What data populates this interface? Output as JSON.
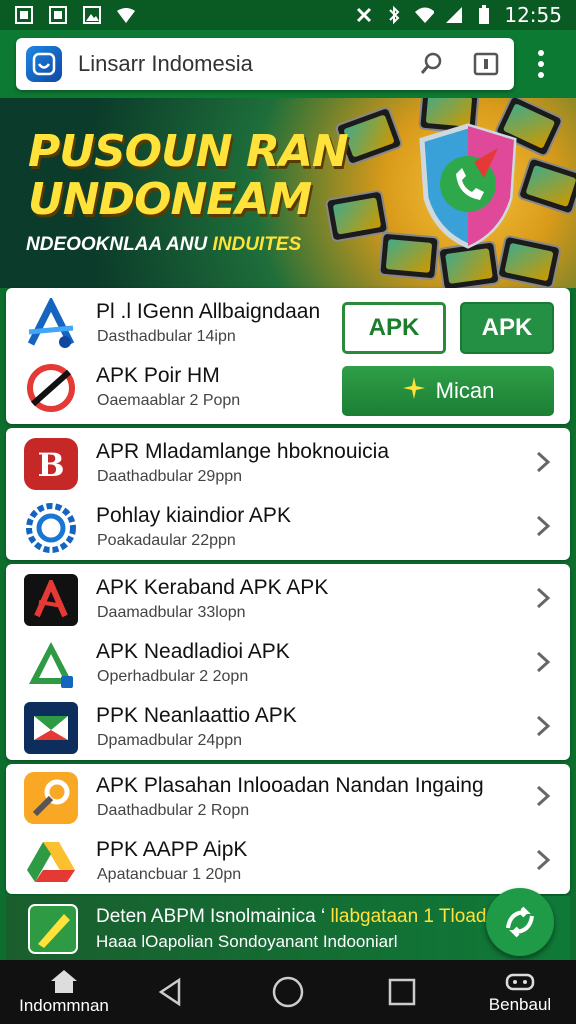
{
  "status_bar": {
    "time": "12:55",
    "left_icons": [
      "notification-square-icon",
      "notification-square-icon",
      "image-icon",
      "vpn-shield-icon"
    ],
    "right_icons": [
      "nfc-icon",
      "bluetooth-icon",
      "wifi-icon",
      "signal-icon",
      "battery-icon"
    ]
  },
  "search": {
    "text": "Linsarr Indomesia"
  },
  "banner": {
    "title_line1": "PUSOUN RAN",
    "title_line2": "UNDONEAM",
    "subtitle_white": "NDEOOKNLAA ANU ",
    "subtitle_yellow": "INDUITES"
  },
  "cards": [
    {
      "rows": [
        {
          "title": "Pl .l IGenn Allbaigndaan",
          "sub": "Dasthadbular 14ipn"
        },
        {
          "title": "APK Poir HM",
          "sub": "Oaemaablar 2 Popn"
        }
      ],
      "buttons": {
        "apk_outline": "APK",
        "apk_filled": "APK",
        "mican": "Mican"
      }
    },
    {
      "rows": [
        {
          "title": "APR Mladamlange hboknouicia",
          "sub": "Daathadbular 29ppn"
        },
        {
          "title": "Pohlay kiaindior APK",
          "sub": "Poakadaular 22ppn"
        }
      ]
    },
    {
      "rows": [
        {
          "title": "APK Keraband APK APK",
          "sub": "Daamadbular 33lopn"
        },
        {
          "title": "APK Neadladioi APK",
          "sub": "Operhadbular 2 2opn"
        },
        {
          "title": "PPK Neanlaattio APK",
          "sub": "Dpamadbular 24ppn"
        }
      ]
    },
    {
      "rows": [
        {
          "title": "APK Plasahan Inlooadan Nandan Ingaing",
          "sub": "Daathadbular 2 Ropn"
        },
        {
          "title": "PPK AAPP AipK",
          "sub": "Apatancbuar 1 20pn"
        }
      ]
    }
  ],
  "promo": {
    "line1_white": "Deten ABPM Isnolmainica ‘ ",
    "line1_yellow": "llabgataan 1 Tload",
    "line2": "Haaa lOapolian Sondoyanant Indooniarl"
  },
  "nav": {
    "home_label": "Indommnan",
    "right_label": "Benbaul"
  },
  "colors": {
    "primary_green": "#0d7a33",
    "button_green": "#239043",
    "banner_yellow": "#ffe23a"
  }
}
